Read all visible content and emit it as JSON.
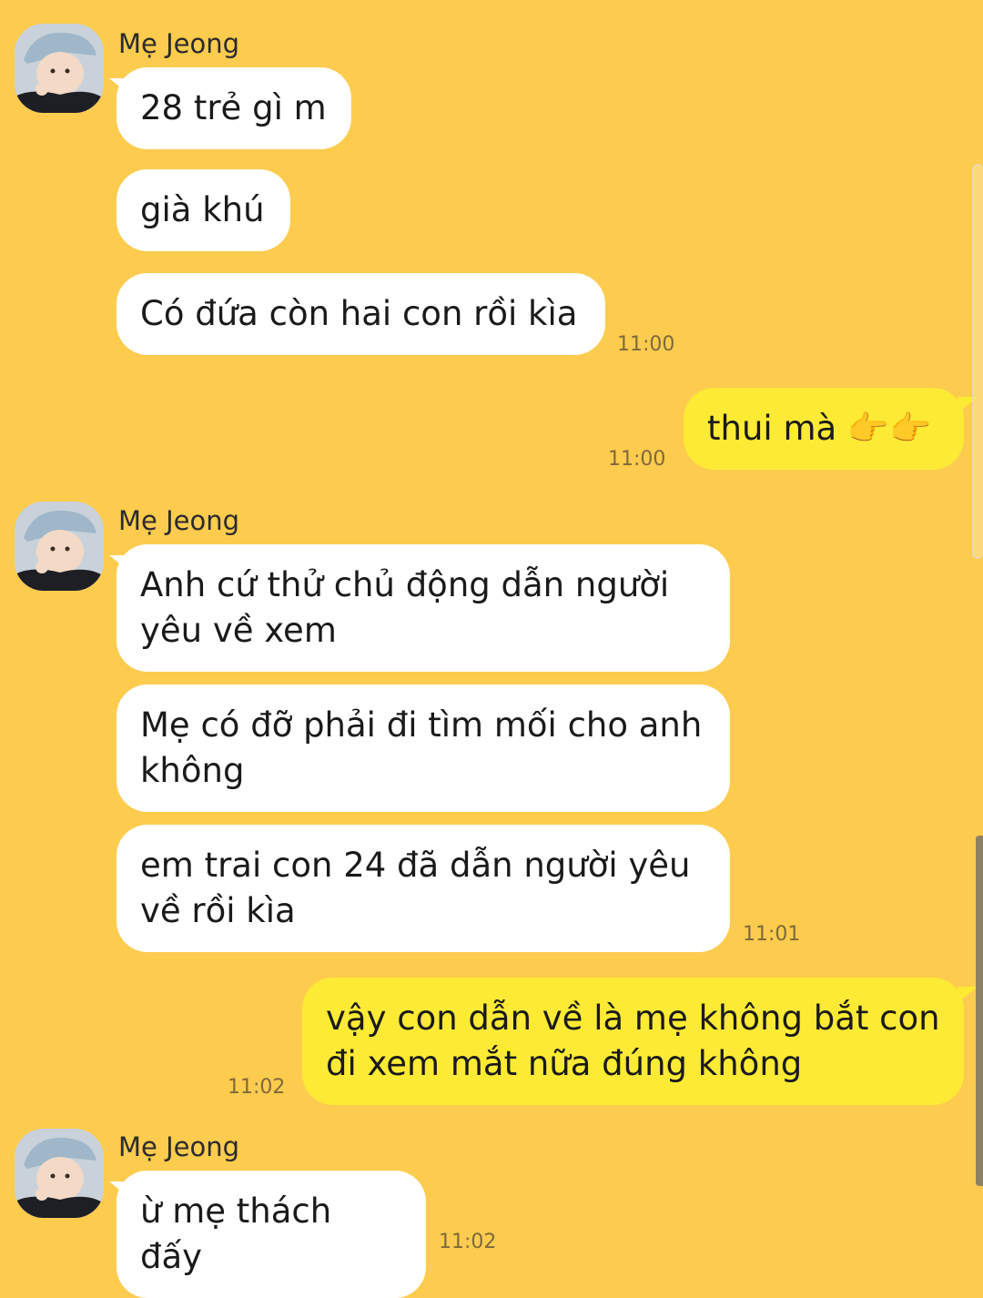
{
  "colors": {
    "background": "#FDCB4E",
    "incoming_bubble": "#FFFFFF",
    "outgoing_bubble": "#FDEA35",
    "timestamp": "#7D6A3A"
  },
  "groups": [
    {
      "sender": "Mẹ Jeong",
      "messages": [
        "28 trẻ gì m",
        "già khú",
        "Có đứa còn hai con rồi kìa"
      ],
      "time": "11:00"
    },
    {
      "outgoing": true,
      "messages": [
        "thui mà 👉👉"
      ],
      "time": "11:00"
    },
    {
      "sender": "Mẹ Jeong",
      "messages": [
        "Anh cứ thử chủ động dẫn người yêu về xem",
        "Mẹ có đỡ phải đi tìm mối cho anh không",
        "em trai con 24 đã dẫn người yêu về rồi kìa"
      ],
      "time": "11:01"
    },
    {
      "outgoing": true,
      "messages": [
        "vậy con dẫn về là mẹ không bắt con đi xem mắt nữa đúng không"
      ],
      "time": "11:02"
    },
    {
      "sender": "Mẹ Jeong",
      "messages": [
        "ừ mẹ thách đấy"
      ],
      "time": "11:02"
    }
  ]
}
